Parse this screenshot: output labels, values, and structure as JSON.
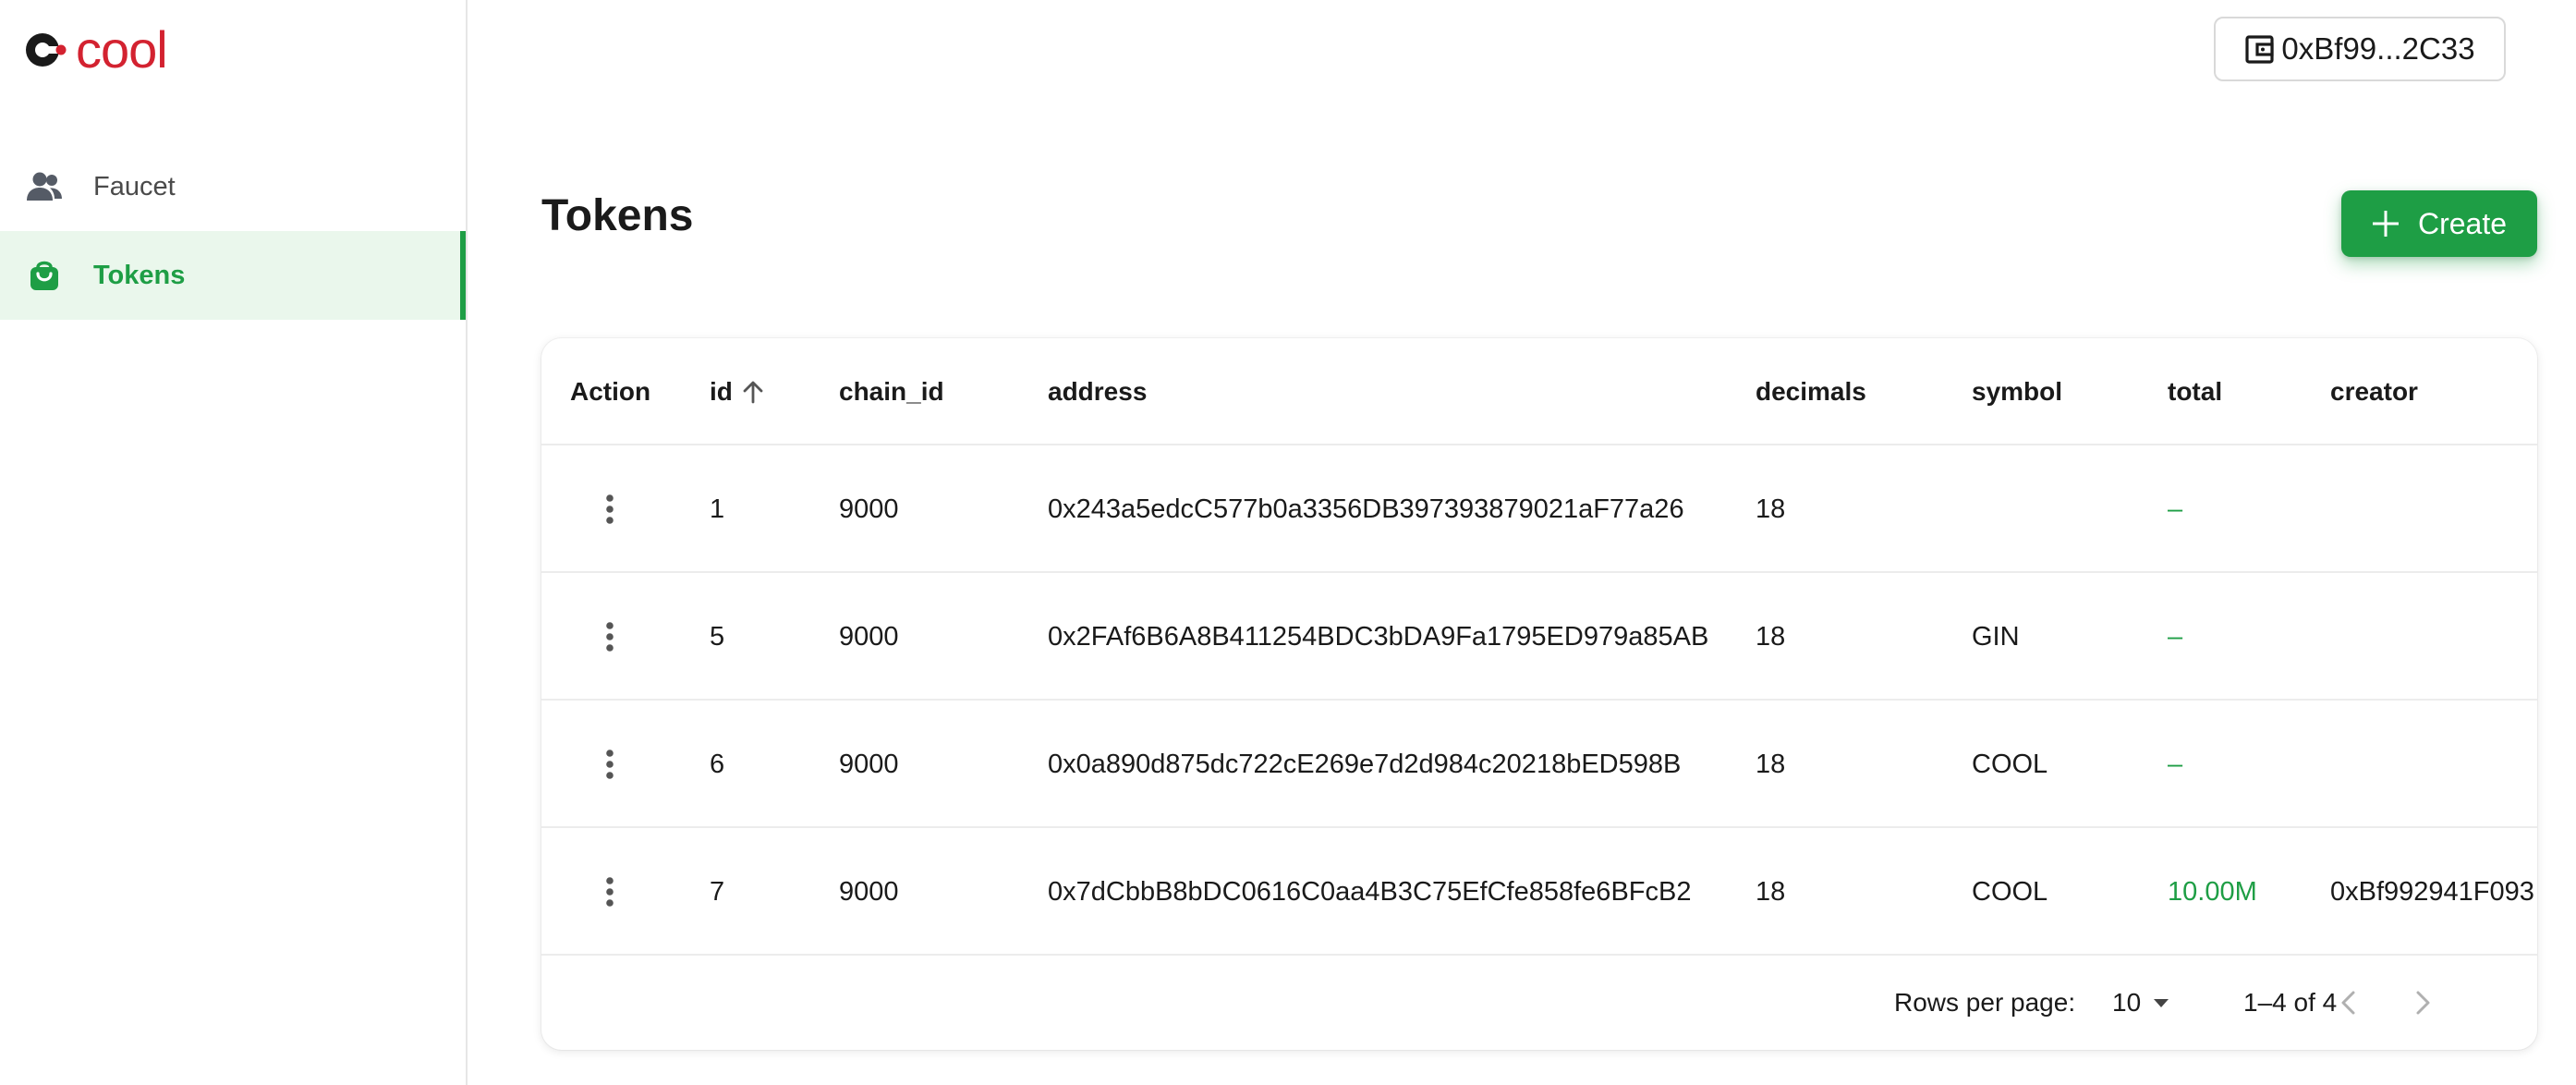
{
  "app": {
    "logo_text": "cool"
  },
  "sidebar": {
    "items": [
      {
        "label": "Faucet",
        "icon": "users-icon",
        "active": false
      },
      {
        "label": "Tokens",
        "icon": "shopping-bag-icon",
        "active": true
      }
    ]
  },
  "header": {
    "wallet_address": "0xBf99...2C33",
    "wallet_icon": "wallet-icon"
  },
  "main": {
    "title": "Tokens",
    "create_label": "Create"
  },
  "table": {
    "columns": [
      "Action",
      "id",
      "chain_id",
      "address",
      "decimals",
      "symbol",
      "total",
      "creator"
    ],
    "sort_column": "id",
    "sort_direction": "ascending",
    "rows": [
      {
        "id": "1",
        "chain_id": "9000",
        "address": "0x243a5edcC577b0a3356DB397393879021aF77a26",
        "decimals": "18",
        "symbol": "",
        "total": "–",
        "creator": ""
      },
      {
        "id": "5",
        "chain_id": "9000",
        "address": "0x2FAf6B6A8B411254BDC3bDA9Fa1795ED979a85AB",
        "decimals": "18",
        "symbol": "GIN",
        "total": "–",
        "creator": ""
      },
      {
        "id": "6",
        "chain_id": "9000",
        "address": "0x0a890d875dc722cE269e7d2d984c20218bED598B",
        "decimals": "18",
        "symbol": "COOL",
        "total": "–",
        "creator": ""
      },
      {
        "id": "7",
        "chain_id": "9000",
        "address": "0x7dCbbB8bDC0616C0aa4B3C75EfCfe858fe6BFcB2",
        "decimals": "18",
        "symbol": "COOL",
        "total": "10.00M",
        "creator": "0xBf992941F093"
      }
    ]
  },
  "pagination": {
    "rows_per_page_label": "Rows per page:",
    "rows_per_page_value": "10",
    "range_text": "1–4 of 4"
  },
  "colors": {
    "accent": "#1e9e45",
    "accent_bg": "#eaf7ec",
    "logo": "#d32230"
  }
}
